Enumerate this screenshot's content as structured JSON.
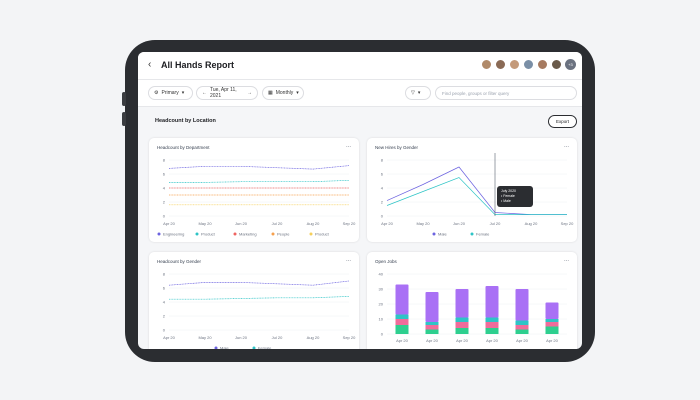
{
  "header": {
    "back_icon": "chevron-left-icon",
    "title": "All Hands Report",
    "avatar_colors": [
      "#b08a6a",
      "#8a6a55",
      "#c49a7a",
      "#7a8fa6",
      "#a67a60",
      "#6a5a4a"
    ],
    "more_avatars": "+3"
  },
  "filters": {
    "primary_label": "Primary",
    "date_label": "Tue, Apr 11, 2021",
    "period_label": "Monthly",
    "search_placeholder": "Find people, groups or filter query"
  },
  "section": {
    "title": "Headcount by Location",
    "export_label": "Export"
  },
  "cards": {
    "dept": {
      "title": "Headcount by Department",
      "menu": "...",
      "x_labels": [
        "Apr 20",
        "May 20",
        "Jun 20",
        "Jul 20",
        "Aug 20",
        "Sep 20"
      ],
      "y_labels": [
        "8",
        "6",
        "4",
        "2",
        "0"
      ],
      "legend": [
        "Engineering",
        "Product",
        "Marketing",
        "People",
        "Product"
      ]
    },
    "hires": {
      "title": "New Hires by Gender",
      "menu": "...",
      "x_labels": [
        "Apr 20",
        "May 20",
        "Jun 20",
        "Jul 20",
        "Aug 20",
        "Sep 20"
      ],
      "y_labels": [
        "8",
        "6",
        "4",
        "2",
        "0"
      ],
      "legend": [
        "Male",
        "Female"
      ],
      "tooltip_title": "July 2020",
      "tooltip_rows": [
        "Female",
        "Male"
      ]
    },
    "gender": {
      "title": "Headcount by Gender",
      "menu": "...",
      "x_labels": [
        "Apr 20",
        "May 20",
        "Jun 20",
        "Jul 20",
        "Aug 20",
        "Sep 20"
      ],
      "y_labels": [
        "8",
        "6",
        "4",
        "2",
        "0"
      ],
      "legend": [
        "Male",
        "Female"
      ]
    },
    "jobs": {
      "title": "Open Jobs",
      "menu": "...",
      "x_labels": [
        "Apr 20",
        "Apr 20",
        "Apr 20",
        "Apr 20",
        "Apr 20",
        "Apr 20"
      ],
      "y_labels": [
        "40",
        "30",
        "20",
        "10",
        "0"
      ]
    }
  },
  "colors": {
    "purple": "#6c63e0",
    "teal": "#2ec4c6",
    "red": "#ef6461",
    "orange": "#f6a04d",
    "yellow": "#f5cf5a",
    "violet": "#a970f5",
    "green": "#2ecf8f",
    "pink": "#f06c9b"
  },
  "chart_data": [
    {
      "type": "line",
      "title": "Headcount by Department",
      "categories": [
        "Apr 20",
        "May 20",
        "Jun 20",
        "Jul 20",
        "Aug 20",
        "Sep 20"
      ],
      "ylim": [
        0,
        8
      ],
      "series": [
        {
          "name": "Engineering",
          "values": [
            6.8,
            7.1,
            7.1,
            6.9,
            6.7,
            7.2
          ]
        },
        {
          "name": "Product",
          "values": [
            4.8,
            4.8,
            4.9,
            4.9,
            4.9,
            5.1
          ]
        },
        {
          "name": "Marketing",
          "values": [
            4.0,
            4.0,
            4.0,
            4.0,
            4.0,
            4.0
          ]
        },
        {
          "name": "People",
          "values": [
            3.0,
            3.0,
            3.0,
            3.0,
            3.0,
            3.0
          ]
        },
        {
          "name": "Product",
          "values": [
            1.6,
            1.6,
            1.6,
            1.6,
            1.6,
            1.6
          ]
        }
      ]
    },
    {
      "type": "line",
      "title": "New Hires by Gender",
      "categories": [
        "Apr 20",
        "May 20",
        "Jun 20",
        "Jul 20",
        "Aug 20",
        "Sep 20"
      ],
      "ylim": [
        0,
        8
      ],
      "series": [
        {
          "name": "Male",
          "values": [
            2.2,
            4.5,
            7.0,
            0.5,
            0.2,
            0.2
          ]
        },
        {
          "name": "Female",
          "values": [
            1.5,
            3.5,
            5.5,
            0.2,
            0.2,
            0.2
          ]
        }
      ]
    },
    {
      "type": "line",
      "title": "Headcount by Gender",
      "categories": [
        "Apr 20",
        "May 20",
        "Jun 20",
        "Jul 20",
        "Aug 20",
        "Sep 20"
      ],
      "ylim": [
        0,
        8
      ],
      "series": [
        {
          "name": "Male",
          "values": [
            6.4,
            6.8,
            6.8,
            6.6,
            6.4,
            7.0
          ]
        },
        {
          "name": "Female",
          "values": [
            4.4,
            4.4,
            4.5,
            4.6,
            4.6,
            4.8
          ]
        }
      ]
    },
    {
      "type": "bar",
      "title": "Open Jobs",
      "categories": [
        "Apr 20",
        "Apr 20",
        "Apr 20",
        "Apr 20",
        "Apr 20",
        "Apr 20"
      ],
      "ylim": [
        0,
        40
      ],
      "series": [
        {
          "name": "",
          "values": [
            6,
            3,
            4,
            4,
            3,
            5
          ]
        },
        {
          "name": "",
          "values": [
            4,
            3,
            4,
            4,
            3,
            3
          ]
        },
        {
          "name": "",
          "values": [
            3,
            2,
            3,
            3,
            3,
            2
          ]
        },
        {
          "name": "",
          "values": [
            20,
            20,
            19,
            21,
            21,
            11
          ]
        }
      ]
    }
  ]
}
